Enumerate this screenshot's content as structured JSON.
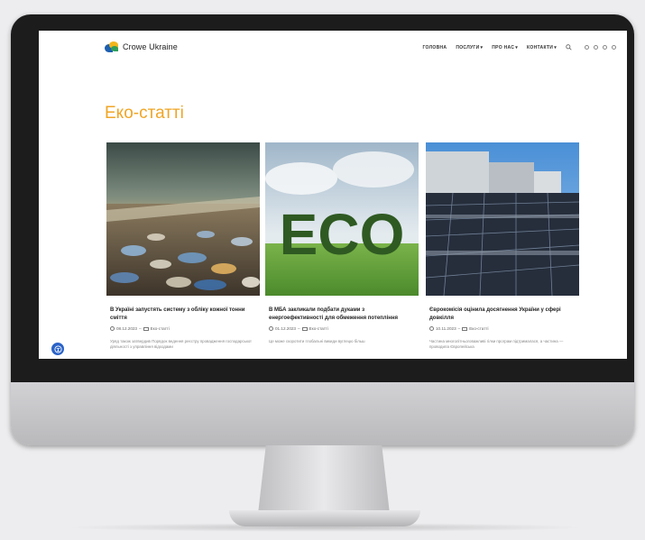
{
  "site": {
    "logo_text": "Crowe Ukraine",
    "nav": [
      {
        "label": "ГОЛОВНА",
        "caret": ""
      },
      {
        "label": "ПОСЛУГИ",
        "caret": "▾"
      },
      {
        "label": "ПРО НАС",
        "caret": "▾"
      },
      {
        "label": "КОНТАКТИ",
        "caret": "▾"
      }
    ],
    "page_title": "Еко-статті"
  },
  "cards": [
    {
      "title": "В Україні запустять систему з обліку кожної тонни сміття",
      "date": "08.12.2023",
      "category": "Еко-статті",
      "excerpt": "Уряд також затвердив Порядок ведення реєстру провадження господарської діяльності з управління відходами"
    },
    {
      "title": "В МБА закликали подбати дуками з енергоефективності для обмеження потепління",
      "date": "01.12.2023",
      "category": "Еко-статті",
      "excerpt": "Це може скоротити глобальні викиди вуглецю більш"
    },
    {
      "title": "Єврокомісія оцінила досягнення України у сфері довкілля",
      "date": "10.11.2023",
      "category": "Еко-статті",
      "excerpt": "Частина многолітньоговажливі гілки програм підтрималася, а частина — проводила Європейська"
    }
  ],
  "eco_sign_text": "ECO",
  "colors": {
    "accent": "#f0a524",
    "access_button": "#2a63c8"
  }
}
